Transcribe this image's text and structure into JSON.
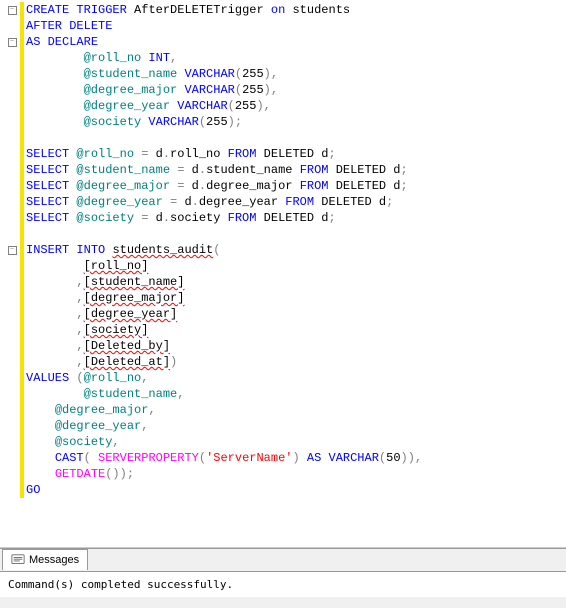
{
  "code": {
    "lines": [
      {
        "fold": true,
        "parts": [
          {
            "t": "CREATE",
            "c": "kw-blue"
          },
          {
            "t": " ",
            "c": ""
          },
          {
            "t": "TRIGGER",
            "c": "kw-blue"
          },
          {
            "t": " AfterDELETETrigger ",
            "c": "kw-black"
          },
          {
            "t": "on",
            "c": "kw-blue"
          },
          {
            "t": " students",
            "c": "kw-black"
          }
        ]
      },
      {
        "fold": false,
        "parts": [
          {
            "t": "AFTER",
            "c": "kw-blue"
          },
          {
            "t": " ",
            "c": ""
          },
          {
            "t": "DELETE",
            "c": "kw-blue"
          }
        ]
      },
      {
        "fold": true,
        "parts": [
          {
            "t": "AS",
            "c": "kw-blue"
          },
          {
            "t": " ",
            "c": ""
          },
          {
            "t": "DECLARE",
            "c": "kw-blue"
          }
        ]
      },
      {
        "fold": false,
        "parts": [
          {
            "t": "        @roll_no ",
            "c": "kw-teal"
          },
          {
            "t": "INT",
            "c": "kw-blue"
          },
          {
            "t": ",",
            "c": "kw-gray"
          }
        ]
      },
      {
        "fold": false,
        "parts": [
          {
            "t": "        @student_name ",
            "c": "kw-teal"
          },
          {
            "t": "VARCHAR",
            "c": "kw-blue"
          },
          {
            "t": "(",
            "c": "kw-gray"
          },
          {
            "t": "255",
            "c": "kw-black"
          },
          {
            "t": "),",
            "c": "kw-gray"
          }
        ]
      },
      {
        "fold": false,
        "parts": [
          {
            "t": "        @degree_major ",
            "c": "kw-teal"
          },
          {
            "t": "VARCHAR",
            "c": "kw-blue"
          },
          {
            "t": "(",
            "c": "kw-gray"
          },
          {
            "t": "255",
            "c": "kw-black"
          },
          {
            "t": "),",
            "c": "kw-gray"
          }
        ]
      },
      {
        "fold": false,
        "parts": [
          {
            "t": "        @degree_year ",
            "c": "kw-teal"
          },
          {
            "t": "VARCHAR",
            "c": "kw-blue"
          },
          {
            "t": "(",
            "c": "kw-gray"
          },
          {
            "t": "255",
            "c": "kw-black"
          },
          {
            "t": "),",
            "c": "kw-gray"
          }
        ]
      },
      {
        "fold": false,
        "parts": [
          {
            "t": "        @society ",
            "c": "kw-teal"
          },
          {
            "t": "VARCHAR",
            "c": "kw-blue"
          },
          {
            "t": "(",
            "c": "kw-gray"
          },
          {
            "t": "255",
            "c": "kw-black"
          },
          {
            "t": ");",
            "c": "kw-gray"
          }
        ]
      },
      {
        "fold": false,
        "parts": [
          {
            "t": " ",
            "c": ""
          }
        ]
      },
      {
        "fold": false,
        "parts": [
          {
            "t": "SELECT",
            "c": "kw-blue"
          },
          {
            "t": " ",
            "c": ""
          },
          {
            "t": "@roll_no",
            "c": "kw-teal"
          },
          {
            "t": " ",
            "c": ""
          },
          {
            "t": "=",
            "c": "kw-gray"
          },
          {
            "t": " d",
            "c": "kw-black"
          },
          {
            "t": ".",
            "c": "kw-gray"
          },
          {
            "t": "roll_no ",
            "c": "kw-black"
          },
          {
            "t": "FROM",
            "c": "kw-blue"
          },
          {
            "t": " DELETED d",
            "c": "kw-black"
          },
          {
            "t": ";",
            "c": "kw-gray"
          }
        ]
      },
      {
        "fold": false,
        "parts": [
          {
            "t": "SELECT",
            "c": "kw-blue"
          },
          {
            "t": " ",
            "c": ""
          },
          {
            "t": "@student_name",
            "c": "kw-teal"
          },
          {
            "t": " ",
            "c": ""
          },
          {
            "t": "=",
            "c": "kw-gray"
          },
          {
            "t": " d",
            "c": "kw-black"
          },
          {
            "t": ".",
            "c": "kw-gray"
          },
          {
            "t": "student_name ",
            "c": "kw-black"
          },
          {
            "t": "FROM",
            "c": "kw-blue"
          },
          {
            "t": " DELETED d",
            "c": "kw-black"
          },
          {
            "t": ";",
            "c": "kw-gray"
          }
        ]
      },
      {
        "fold": false,
        "parts": [
          {
            "t": "SELECT",
            "c": "kw-blue"
          },
          {
            "t": " ",
            "c": ""
          },
          {
            "t": "@degree_major",
            "c": "kw-teal"
          },
          {
            "t": " ",
            "c": ""
          },
          {
            "t": "=",
            "c": "kw-gray"
          },
          {
            "t": " d",
            "c": "kw-black"
          },
          {
            "t": ".",
            "c": "kw-gray"
          },
          {
            "t": "degree_major ",
            "c": "kw-black"
          },
          {
            "t": "FROM",
            "c": "kw-blue"
          },
          {
            "t": " DELETED d",
            "c": "kw-black"
          },
          {
            "t": ";",
            "c": "kw-gray"
          }
        ]
      },
      {
        "fold": false,
        "parts": [
          {
            "t": "SELECT",
            "c": "kw-blue"
          },
          {
            "t": " ",
            "c": ""
          },
          {
            "t": "@degree_year",
            "c": "kw-teal"
          },
          {
            "t": " ",
            "c": ""
          },
          {
            "t": "=",
            "c": "kw-gray"
          },
          {
            "t": " d",
            "c": "kw-black"
          },
          {
            "t": ".",
            "c": "kw-gray"
          },
          {
            "t": "degree_year ",
            "c": "kw-black"
          },
          {
            "t": "FROM",
            "c": "kw-blue"
          },
          {
            "t": " DELETED d",
            "c": "kw-black"
          },
          {
            "t": ";",
            "c": "kw-gray"
          }
        ]
      },
      {
        "fold": false,
        "parts": [
          {
            "t": "SELECT",
            "c": "kw-blue"
          },
          {
            "t": " ",
            "c": ""
          },
          {
            "t": "@society",
            "c": "kw-teal"
          },
          {
            "t": " ",
            "c": ""
          },
          {
            "t": "=",
            "c": "kw-gray"
          },
          {
            "t": " d",
            "c": "kw-black"
          },
          {
            "t": ".",
            "c": "kw-gray"
          },
          {
            "t": "society ",
            "c": "kw-black"
          },
          {
            "t": "FROM",
            "c": "kw-blue"
          },
          {
            "t": " DELETED d",
            "c": "kw-black"
          },
          {
            "t": ";",
            "c": "kw-gray"
          }
        ]
      },
      {
        "fold": false,
        "parts": [
          {
            "t": " ",
            "c": ""
          }
        ]
      },
      {
        "fold": true,
        "parts": [
          {
            "t": "INSERT",
            "c": "kw-blue"
          },
          {
            "t": " ",
            "c": ""
          },
          {
            "t": "INTO",
            "c": "kw-blue"
          },
          {
            "t": " ",
            "c": ""
          },
          {
            "t": "students_audit",
            "c": "kw-black squiggly"
          },
          {
            "t": "(",
            "c": "kw-gray"
          }
        ]
      },
      {
        "fold": false,
        "parts": [
          {
            "t": "        ",
            "c": ""
          },
          {
            "t": "[roll_no]",
            "c": "kw-black squiggly"
          }
        ]
      },
      {
        "fold": false,
        "parts": [
          {
            "t": "       ",
            "c": ""
          },
          {
            "t": ",",
            "c": "kw-gray"
          },
          {
            "t": "[student_name]",
            "c": "kw-black squiggly"
          }
        ]
      },
      {
        "fold": false,
        "parts": [
          {
            "t": "       ",
            "c": ""
          },
          {
            "t": ",",
            "c": "kw-gray"
          },
          {
            "t": "[degree_major]",
            "c": "kw-black squiggly"
          }
        ]
      },
      {
        "fold": false,
        "parts": [
          {
            "t": "       ",
            "c": ""
          },
          {
            "t": ",",
            "c": "kw-gray"
          },
          {
            "t": "[degree_year]",
            "c": "kw-black squiggly"
          }
        ]
      },
      {
        "fold": false,
        "parts": [
          {
            "t": "       ",
            "c": ""
          },
          {
            "t": ",",
            "c": "kw-gray"
          },
          {
            "t": "[society]",
            "c": "kw-black squiggly"
          }
        ]
      },
      {
        "fold": false,
        "parts": [
          {
            "t": "       ",
            "c": ""
          },
          {
            "t": ",",
            "c": "kw-gray"
          },
          {
            "t": "[Deleted_by]",
            "c": "kw-black squiggly"
          }
        ]
      },
      {
        "fold": false,
        "parts": [
          {
            "t": "       ",
            "c": ""
          },
          {
            "t": ",",
            "c": "kw-gray"
          },
          {
            "t": "[Deleted_at]",
            "c": "kw-black squiggly"
          },
          {
            "t": ")",
            "c": "kw-gray"
          }
        ]
      },
      {
        "fold": false,
        "parts": [
          {
            "t": "VALUES",
            "c": "kw-blue"
          },
          {
            "t": " ",
            "c": ""
          },
          {
            "t": "(",
            "c": "kw-gray"
          },
          {
            "t": "@roll_no",
            "c": "kw-teal"
          },
          {
            "t": ",",
            "c": "kw-gray"
          }
        ]
      },
      {
        "fold": false,
        "parts": [
          {
            "t": "        ",
            "c": ""
          },
          {
            "t": "@student_name",
            "c": "kw-teal"
          },
          {
            "t": ",",
            "c": "kw-gray"
          }
        ]
      },
      {
        "fold": false,
        "parts": [
          {
            "t": "    ",
            "c": ""
          },
          {
            "t": "@degree_major",
            "c": "kw-teal"
          },
          {
            "t": ",",
            "c": "kw-gray"
          }
        ]
      },
      {
        "fold": false,
        "parts": [
          {
            "t": "    ",
            "c": ""
          },
          {
            "t": "@degree_year",
            "c": "kw-teal"
          },
          {
            "t": ",",
            "c": "kw-gray"
          }
        ]
      },
      {
        "fold": false,
        "parts": [
          {
            "t": "    ",
            "c": ""
          },
          {
            "t": "@society",
            "c": "kw-teal"
          },
          {
            "t": ",",
            "c": "kw-gray"
          }
        ]
      },
      {
        "fold": false,
        "parts": [
          {
            "t": "    ",
            "c": ""
          },
          {
            "t": "CAST",
            "c": "kw-blue"
          },
          {
            "t": "( ",
            "c": "kw-gray"
          },
          {
            "t": "SERVERPROPERTY",
            "c": "kw-magenta"
          },
          {
            "t": "(",
            "c": "kw-gray"
          },
          {
            "t": "'ServerName'",
            "c": "kw-red"
          },
          {
            "t": ") ",
            "c": "kw-gray"
          },
          {
            "t": "AS",
            "c": "kw-blue"
          },
          {
            "t": " ",
            "c": ""
          },
          {
            "t": "VARCHAR",
            "c": "kw-blue"
          },
          {
            "t": "(",
            "c": "kw-gray"
          },
          {
            "t": "50",
            "c": "kw-black"
          },
          {
            "t": ")),",
            "c": "kw-gray"
          }
        ]
      },
      {
        "fold": false,
        "parts": [
          {
            "t": "    ",
            "c": ""
          },
          {
            "t": "GETDATE",
            "c": "kw-magenta"
          },
          {
            "t": "());",
            "c": "kw-gray"
          }
        ]
      },
      {
        "fold": false,
        "parts": [
          {
            "t": "GO",
            "c": "kw-blue"
          }
        ]
      }
    ]
  },
  "messages": {
    "tab_label": "Messages",
    "body": "Command(s) completed successfully."
  }
}
